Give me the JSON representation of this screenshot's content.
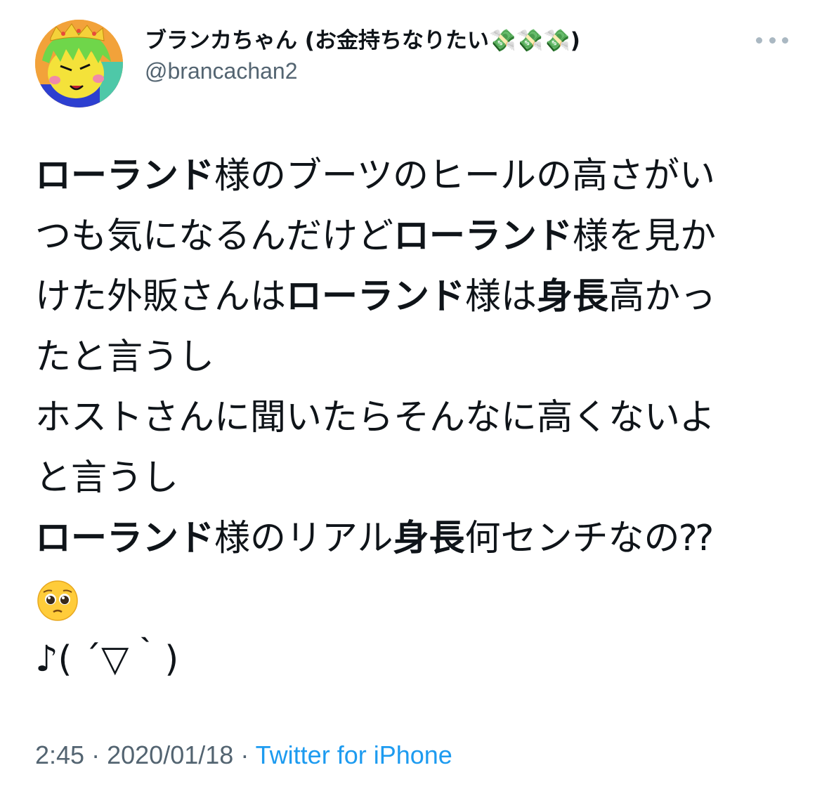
{
  "tweet": {
    "display_name": "ブランカちゃん (お金持ちなりたい💸💸💸)",
    "handle": "@brancachan2",
    "more_icon": "more-horizontal-icon",
    "lines": [
      [
        {
          "t": "ローランド",
          "b": true
        },
        {
          "t": "様のブーツのヒールの高さがい",
          "b": false
        }
      ],
      [
        {
          "t": "つも気になるんだけど",
          "b": false
        },
        {
          "t": "ローランド",
          "b": true
        },
        {
          "t": "様を見か",
          "b": false
        }
      ],
      [
        {
          "t": "けた外販さんは",
          "b": false
        },
        {
          "t": "ローランド",
          "b": true
        },
        {
          "t": "様は",
          "b": false
        },
        {
          "t": "身長",
          "b": true
        },
        {
          "t": "高かっ",
          "b": false
        }
      ],
      [
        {
          "t": "たと言うし",
          "b": false
        }
      ],
      [
        {
          "t": "ホストさんに聞いたらそんなに高くないよ",
          "b": false
        }
      ],
      [
        {
          "t": "と言うし",
          "b": false
        }
      ],
      [
        {
          "t": "ローランド",
          "b": true
        },
        {
          "t": "様のリアル",
          "b": false
        },
        {
          "t": "身長",
          "b": true
        },
        {
          "t": "何センチなの⁇",
          "b": false
        }
      ],
      [
        {
          "emoji": "pleading-face-emoji"
        }
      ],
      [
        {
          "t": "♪( ´▽｀)",
          "b": false
        }
      ]
    ],
    "time": "2:45",
    "separator": "·",
    "date": "2020/01/18",
    "source": "Twitter for iPhone",
    "colors": {
      "text": "#0f1419",
      "secondary": "#536471",
      "link": "#1d9bf0"
    }
  }
}
